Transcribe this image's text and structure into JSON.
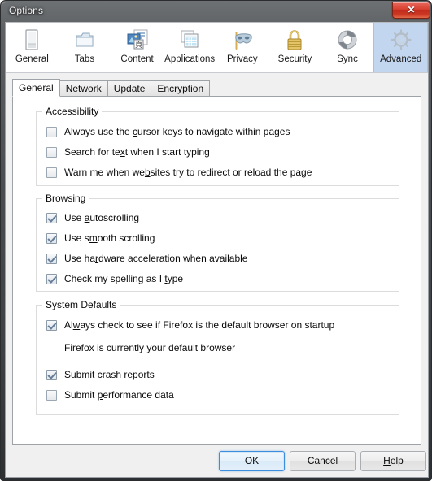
{
  "window": {
    "title": "Options",
    "close_label": "✕"
  },
  "toolbar": {
    "items": [
      {
        "label": "General",
        "icon": "general-icon",
        "selected": false
      },
      {
        "label": "Tabs",
        "icon": "tabs-icon",
        "selected": false
      },
      {
        "label": "Content",
        "icon": "content-icon",
        "selected": false
      },
      {
        "label": "Applications",
        "icon": "applications-icon",
        "selected": false
      },
      {
        "label": "Privacy",
        "icon": "privacy-mask-icon",
        "selected": false
      },
      {
        "label": "Security",
        "icon": "security-lock-icon",
        "selected": false
      },
      {
        "label": "Sync",
        "icon": "sync-icon",
        "selected": false
      },
      {
        "label": "Advanced",
        "icon": "advanced-gear-icon",
        "selected": true
      }
    ],
    "selected_index": 7
  },
  "subtabs": {
    "items": [
      {
        "label": "General",
        "active": true
      },
      {
        "label": "Network",
        "active": false
      },
      {
        "label": "Update",
        "active": false
      },
      {
        "label": "Encryption",
        "active": false
      }
    ],
    "active_index": 0
  },
  "groups": {
    "accessibility": {
      "legend": "Accessibility",
      "options": [
        {
          "pre": "Always use the ",
          "accel": "c",
          "post": "ursor keys to navigate within pages",
          "checked": false
        },
        {
          "pre": "Search for te",
          "accel": "x",
          "post": "t when I start typing",
          "checked": false
        },
        {
          "pre": "Warn me when we",
          "accel": "b",
          "post": "sites try to redirect or reload the page",
          "checked": false
        }
      ]
    },
    "browsing": {
      "legend": "Browsing",
      "options": [
        {
          "pre": "Use ",
          "accel": "a",
          "post": "utoscrolling",
          "checked": true
        },
        {
          "pre": "Use s",
          "accel": "m",
          "post": "ooth scrolling",
          "checked": true
        },
        {
          "pre": "Use ha",
          "accel": "r",
          "post": "dware acceleration when available",
          "checked": true
        },
        {
          "pre": "Check my spelling as I ",
          "accel": "t",
          "post": "ype",
          "checked": true
        }
      ]
    },
    "system_defaults": {
      "legend": "System Defaults",
      "options": [
        {
          "pre": "Al",
          "accel": "w",
          "post": "ays check to see if Firefox is the default browser on startup",
          "checked": true
        },
        {
          "pre": "",
          "accel": "S",
          "post": "ubmit crash reports",
          "checked": true
        },
        {
          "pre": "Submit ",
          "accel": "p",
          "post": "erformance data",
          "checked": false
        }
      ],
      "status_text": "Firefox is currently your default browser"
    }
  },
  "buttons": {
    "ok": {
      "pre": "OK",
      "accel": "",
      "post": "",
      "focused": true
    },
    "cancel": {
      "pre": "Cancel",
      "accel": "",
      "post": "",
      "focused": false
    },
    "help": {
      "pre": "",
      "accel": "H",
      "post": "elp",
      "focused": false
    }
  },
  "colors": {
    "selection": "#c3d6ef",
    "panel_bg": "#ffffff",
    "dialog_bg": "#f0f0f0",
    "close_red": "#d8402f",
    "focus_blue": "#3c8ddd"
  }
}
